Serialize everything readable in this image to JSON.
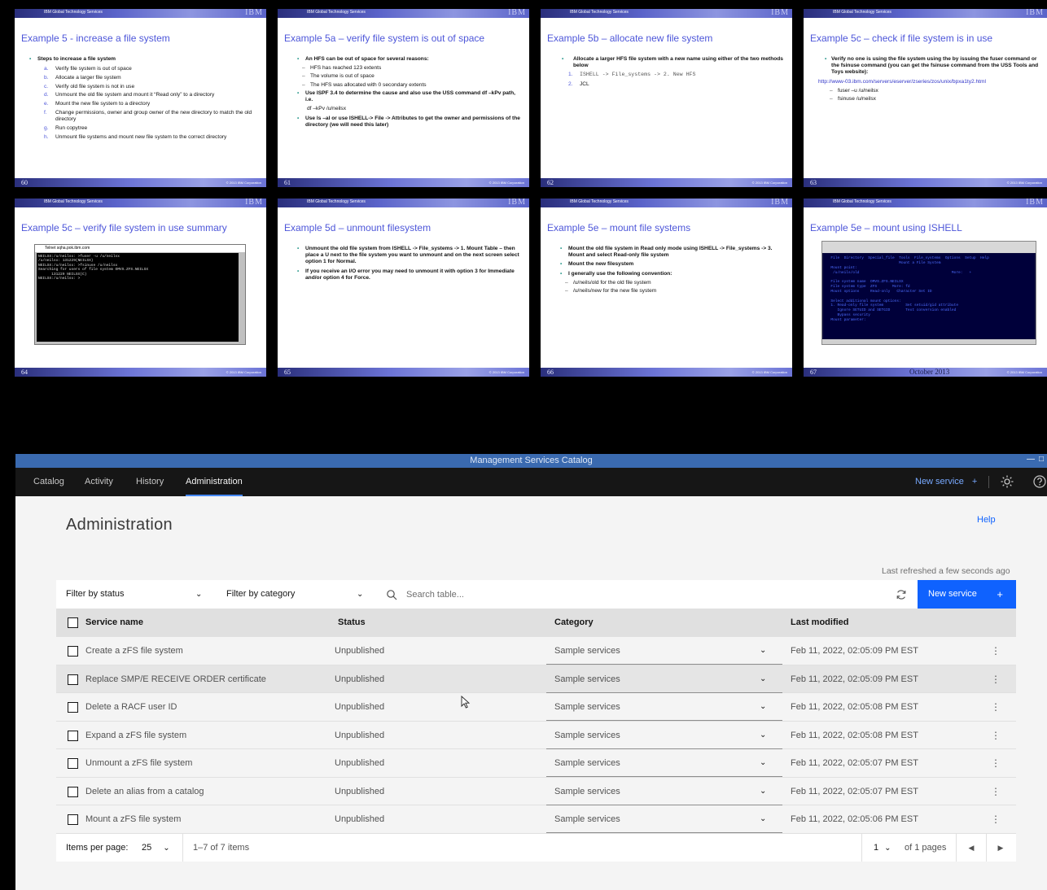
{
  "slides": [
    {
      "header": "IBM Global Technology Services",
      "title": "Example 5 - increase a file system",
      "lead": "Steps to increase a file system",
      "items": [
        {
          "mark": "a.",
          "text": "Verify file system is out of space"
        },
        {
          "mark": "b.",
          "text": "Allocate a larger file system"
        },
        {
          "mark": "c.",
          "text": "Verify old file system is not in use"
        },
        {
          "mark": "d.",
          "text": "Unmount the old file system and mount it “Read only” to a directory"
        },
        {
          "mark": "e.",
          "text": "Mount the new file system to a directory"
        },
        {
          "mark": "f.",
          "text": "Change permissions, owner and group owner of the new directory to match the old directory"
        },
        {
          "mark": "g.",
          "text": "Run copytree"
        },
        {
          "mark": "h.",
          "text": "Unmount file systems and mount new file system to the correct directory"
        }
      ],
      "number": "60",
      "copyright": "© 2013 IBM Corporation"
    },
    {
      "header": "IBM Global Technology Services",
      "title": "Example 5a – verify file system is out of space",
      "lead": "An HFS can be out of space for several reasons:",
      "subs": [
        "HFS has reached 123 extents",
        "The volume is out of space",
        "The HFS was allocated with 0 secondary extents"
      ],
      "b2": "Use ISPF 3.4 to determine the cause and also use the USS command df –kPv path, i.e.",
      "cmd": "df –kPv /u/neilsx",
      "b3": "Use ls –al or use ISHELL-> File -> Attributes to get the owner and permissions of the directory (we will need this later)",
      "number": "61",
      "copyright": "© 2013 IBM Corporation"
    },
    {
      "header": "IBM Global Technology Services",
      "title": "Example 5b – allocate new file system",
      "lead": "Allocate a larger HFS file system with a new name using either of the two methods below",
      "items": [
        {
          "mark": "1.",
          "text": "ISHELL -> File_systems -> 2. New HFS"
        },
        {
          "mark": "2.",
          "text": "JCL"
        }
      ],
      "number": "62",
      "copyright": "© 2013 IBM Corporation"
    },
    {
      "header": "IBM Global Technology Services",
      "title": "Example 5c – check if file system is in use",
      "lead": "Verify no one is using the file system using the by issuing the fuser command or the fsinuse command (you can get the fsinuse command from the USS Tools and Toys website):",
      "link": "http://www-03.ibm.com/servers/eserver/zseries/zos/unix/bpxa1ty2.html",
      "subs": [
        "fuser –u /u/neilsx",
        "fsinuse /u/neilsx"
      ],
      "number": "63",
      "copyright": "© 2013 IBM Corporation"
    },
    {
      "header": "IBM Global Technology Services",
      "title": "Example 5c – verify file system in use summary",
      "terminal_title": "Telnet sqha.pok.ibm.com",
      "terminal_text": "NEILSX:/u/neilsx: >fuser -u /u/neilsx\n/u/neilsx: 131229(NEILSX)\nNEILSX:/u/neilsx: >fsinuse /u/neilsx\nSearching for users of file system OMVS.ZFS.NEILSX\n      131229 NEILSX(C)\nNEILSX:/u/neilsx: >",
      "number": "64",
      "copyright": "© 2013 IBM Corporation"
    },
    {
      "header": "IBM Global Technology Services",
      "title": "Example 5d – unmount filesystem",
      "b1": "Unmount the old file system from ISHELL -> File_systems -> 1. Mount Table – then place a U next to the file system you want to unmount and on the next screen select option 1 for Normal.",
      "b2": "If you receive an I/O error you may need to unmount it with option 3 for Immediate and/or option 4 for Force.",
      "number": "65",
      "copyright": "© 2013 IBM Corporation"
    },
    {
      "header": "IBM Global Technology Services",
      "title": "Example 5e – mount file systems",
      "b1": "Mount the old file system in Read only mode using ISHELL -> File_systems -> 3. Mount and select Read-only file system",
      "b2": "Mount the new filesystem",
      "b3": "I generally use the following convention:",
      "subs": [
        "/u/neils/old for the old file system",
        "/u/neils/new for the new file system"
      ],
      "number": "66",
      "copyright": "© 2013 IBM Corporation"
    },
    {
      "header": "IBM Global Technology Services",
      "title": "Example 5e – mount using ISHELL",
      "ishell_text": "  File  Directory  Special_file  Tools  File_systems  Options  Setup  Help\n                                 Mount a File System\n  Mount point:\n   /u/neils/old                                          More:   +\n\n  File system name  OMVS.ZFS.NEILSX\n  File system type  ZFS       More: fd\n  Mount options     Read-only   Character Set ID\n\n  Select additional mount options:\n  1. Read-only file system          Set setuid/gid attribute\n     Ignore SETUID and SETGID       Text conversion enabled\n     Bypass security\n  Mount parameter:",
      "number": "67",
      "footer_center": "October 2013",
      "copyright": "© 2013 IBM Corporation"
    }
  ],
  "app": {
    "window_title": "Management Services Catalog",
    "tabs": [
      "Catalog",
      "Activity",
      "History",
      "Administration"
    ],
    "active_tab": "Administration",
    "nav_new_service": "New service",
    "page_title": "Administration",
    "help": "Help",
    "last_refreshed": "Last refreshed a few seconds ago",
    "filter_status": "Filter by status",
    "filter_category": "Filter by category",
    "search_placeholder": "Search table...",
    "new_service_button": "New service",
    "columns": [
      "Service name",
      "Status",
      "Category",
      "Last modified"
    ],
    "rows": [
      {
        "name": "Create a zFS file system",
        "status": "Unpublished",
        "category": "Sample services",
        "modified": "Feb 11, 2022, 02:05:09 PM EST"
      },
      {
        "name": "Replace SMP/E RECEIVE ORDER certificate",
        "status": "Unpublished",
        "category": "Sample services",
        "modified": "Feb 11, 2022, 02:05:09 PM EST"
      },
      {
        "name": "Delete a RACF user ID",
        "status": "Unpublished",
        "category": "Sample services",
        "modified": "Feb 11, 2022, 02:05:08 PM EST"
      },
      {
        "name": "Expand a zFS file system",
        "status": "Unpublished",
        "category": "Sample services",
        "modified": "Feb 11, 2022, 02:05:08 PM EST"
      },
      {
        "name": "Unmount a zFS file system",
        "status": "Unpublished",
        "category": "Sample services",
        "modified": "Feb 11, 2022, 02:05:07 PM EST"
      },
      {
        "name": "Delete an alias from a catalog",
        "status": "Unpublished",
        "category": "Sample services",
        "modified": "Feb 11, 2022, 02:05:07 PM EST"
      },
      {
        "name": "Mount a zFS file system",
        "status": "Unpublished",
        "category": "Sample services",
        "modified": "Feb 11, 2022, 02:05:06 PM EST"
      }
    ],
    "pager": {
      "items_per_page_label": "Items per page:",
      "items_per_page": "25",
      "range": "1–7 of 7 items",
      "page": "1",
      "of_pages": "of 1 pages"
    },
    "accent": "#0f62fe"
  }
}
